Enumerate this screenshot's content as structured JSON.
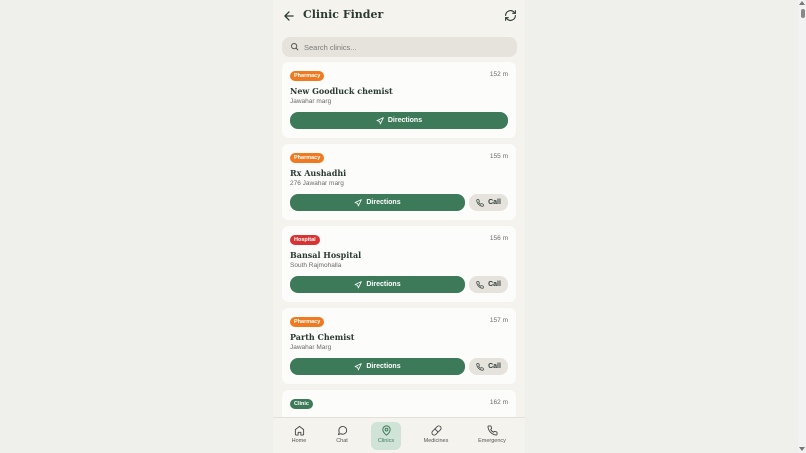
{
  "header": {
    "title": "Clinic Finder",
    "back_icon": "arrow-left-icon",
    "refresh_icon": "refresh-icon"
  },
  "search": {
    "placeholder": "Search clinics..."
  },
  "colors": {
    "primary": "#3d7a5a",
    "pharmacy": "#f07a21",
    "hospital": "#d93333",
    "clinic": "#3d7a5a"
  },
  "results": [
    {
      "type": "Pharmacy",
      "distance": "152 m",
      "name": "New Goodluck chemist",
      "address": "Jawahar marg",
      "directions": "Directions",
      "call": ""
    },
    {
      "type": "Pharmacy",
      "distance": "155 m",
      "name": "Rx Aushadhi",
      "address": "276 Jawahar marg",
      "directions": "Directions",
      "call": "Call"
    },
    {
      "type": "Hospital",
      "distance": "156 m",
      "name": "Bansal Hospital",
      "address": "South Rajmohalla",
      "directions": "Directions",
      "call": "Call"
    },
    {
      "type": "Pharmacy",
      "distance": "157 m",
      "name": "Parth Chemist",
      "address": "Jawahar Marg",
      "directions": "Directions",
      "call": "Call"
    },
    {
      "type": "Clinic",
      "distance": "162 m",
      "name": "",
      "address": "",
      "directions": "",
      "call": ""
    }
  ],
  "nav": [
    {
      "label": "Home",
      "icon": "home-icon"
    },
    {
      "label": "Chat",
      "icon": "chat-icon"
    },
    {
      "label": "Clinics",
      "icon": "map-pin-icon",
      "active": true
    },
    {
      "label": "Medicines",
      "icon": "pill-icon"
    },
    {
      "label": "Emergency",
      "icon": "phone-icon"
    }
  ]
}
